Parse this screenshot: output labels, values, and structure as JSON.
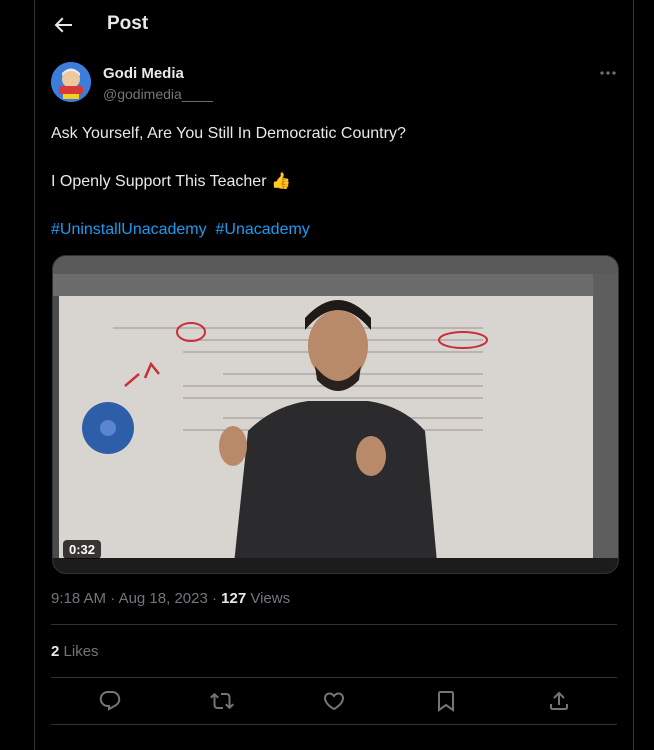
{
  "header": {
    "title": "Post"
  },
  "author": {
    "display_name": "Godi Media",
    "handle": "@godimedia____"
  },
  "tweet": {
    "line1": "Ask Yourself, Are You Still In Democratic Country?",
    "line2": "I Openly Support This Teacher",
    "emoji": "👍",
    "hashtags": [
      "#UninstallUnacademy",
      "#Unacademy"
    ]
  },
  "media": {
    "duration": "0:32"
  },
  "meta": {
    "time": "9:18 AM",
    "date": "Aug 18, 2023",
    "views_count": "127",
    "views_label": "Views"
  },
  "likes": {
    "count": "2",
    "label": "Likes"
  },
  "colors": {
    "accent": "#1d9bf0",
    "muted": "#71767b",
    "text": "#e7e9ea",
    "border": "#2f3336"
  },
  "icons": [
    "back-arrow-icon",
    "more-icon",
    "reply-icon",
    "retweet-icon",
    "like-icon",
    "bookmark-icon",
    "share-icon"
  ]
}
